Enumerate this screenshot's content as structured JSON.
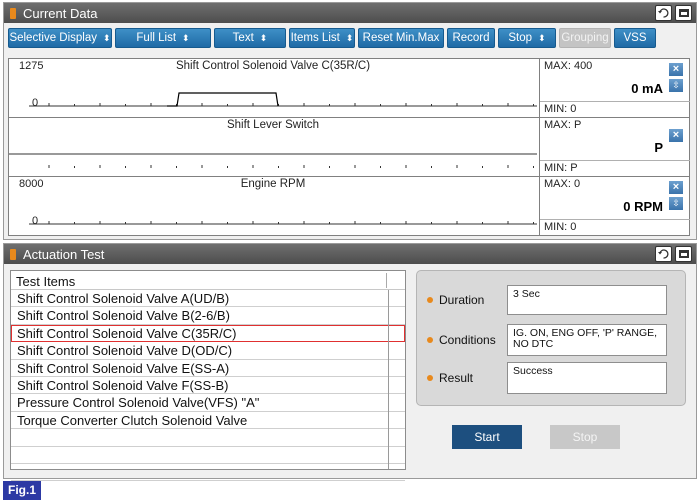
{
  "current_data": {
    "title": "Current Data",
    "retry_label": "Retry",
    "toolbar": [
      {
        "label": "Selective Display",
        "dropdown": true,
        "disabled": false
      },
      {
        "label": "Full List",
        "dropdown": true,
        "disabled": false
      },
      {
        "label": "Text",
        "dropdown": true,
        "disabled": false
      },
      {
        "label": "Items List",
        "dropdown": true,
        "disabled": false
      },
      {
        "label": "Reset Min.Max",
        "dropdown": false,
        "disabled": false
      },
      {
        "label": "Record",
        "dropdown": false,
        "disabled": false
      },
      {
        "label": "Stop",
        "dropdown": true,
        "disabled": false
      },
      {
        "label": "Grouping",
        "dropdown": false,
        "disabled": true
      },
      {
        "label": "VSS",
        "dropdown": false,
        "disabled": false
      }
    ],
    "graphs": [
      {
        "title": "Shift Control Solenoid Valve C(35R/C)",
        "scale_max": "1275",
        "scale_min": "0",
        "max": "MAX: 400",
        "min": "MIN: 0",
        "value": "0 mA",
        "has_scroll": true
      },
      {
        "title": "Shift Lever Switch",
        "scale_max": "",
        "scale_min": "",
        "max": "MAX: P",
        "min": "MIN: P",
        "value": "P",
        "has_scroll": false
      },
      {
        "title": "Engine RPM",
        "scale_max": "8000",
        "scale_min": "0",
        "max": "MAX: 0",
        "min": "MIN: 0",
        "value": "0 RPM",
        "has_scroll": true
      }
    ]
  },
  "actuation_test": {
    "title": "Actuation Test",
    "retry_label": "Retry",
    "list_header": "Test Items",
    "items": [
      "Shift Control Solenoid Valve A(UD/B)",
      "Shift Control Solenoid Valve B(2-6/B)",
      "Shift Control Solenoid Valve C(35R/C)",
      "Shift Control Solenoid Valve D(OD/C)",
      "Shift Control Solenoid Valve E(SS-A)",
      "Shift Control Solenoid Valve F(SS-B)",
      "Pressure Control Solenoid Valve(VFS) \"A\"",
      "Torque Converter Clutch Solenoid Valve",
      "",
      "",
      ""
    ],
    "selected_index": 2,
    "duration_label": "Duration",
    "duration_value": "3 Sec",
    "conditions_label": "Conditions",
    "conditions_value": "IG. ON, ENG OFF, 'P' RANGE, NO DTC",
    "result_label": "Result",
    "result_value": "Success",
    "start_label": "Start",
    "stop_label": "Stop"
  },
  "figure_label": "Fig.1",
  "colors": {
    "toolbar_blue": "#2474b0",
    "accent_orange": "#e8891c",
    "selection_red": "#e03030",
    "start_button": "#1d4f7f",
    "stop_button_disabled": "#c8c8c8",
    "figure_label_bg": "#2c39a4"
  }
}
